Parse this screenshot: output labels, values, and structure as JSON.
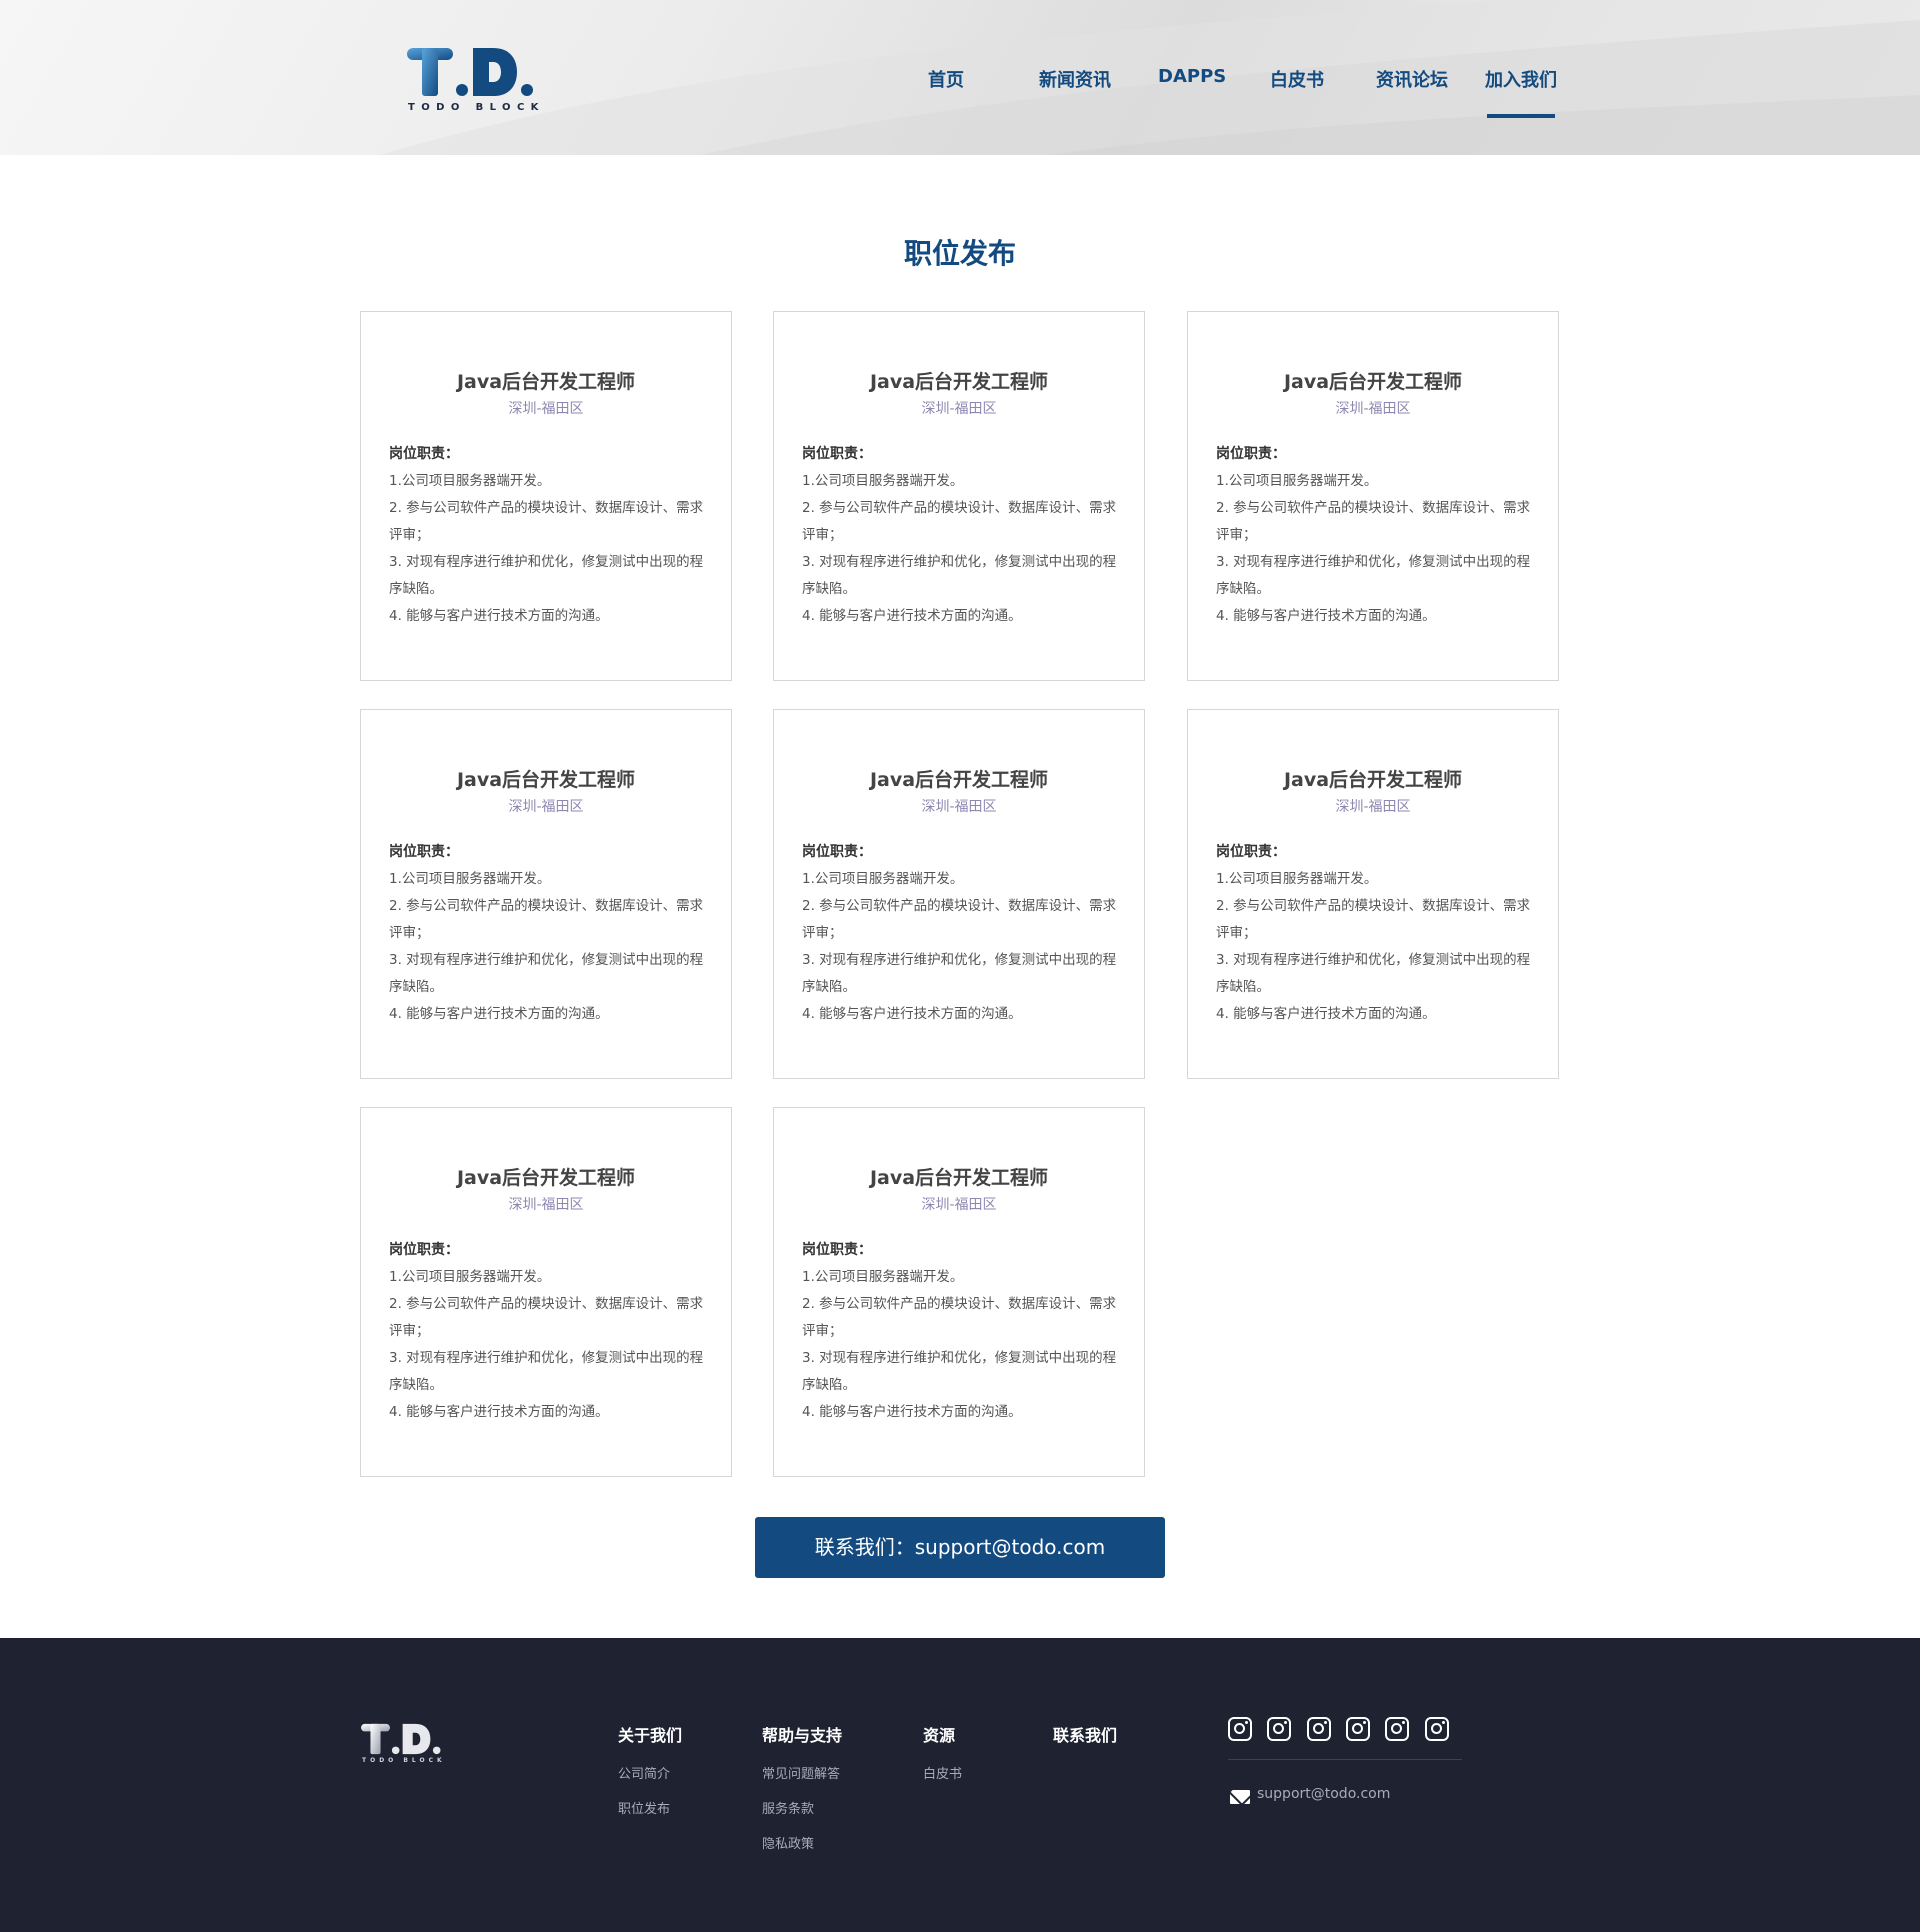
{
  "brand": {
    "logo_text": "T.D.",
    "logo_subtext": "TODO BLOCK"
  },
  "nav": {
    "items": [
      {
        "label": "首页"
      },
      {
        "label": "新闻资讯"
      },
      {
        "label": "DAPPS"
      },
      {
        "label": "白皮书"
      },
      {
        "label": "资讯论坛"
      },
      {
        "label": "加入我们"
      }
    ],
    "active": "加入我们"
  },
  "page_title": "职位发布",
  "jobs": [
    {
      "title": "Java后台开发工程师",
      "location": "深圳-福田区",
      "resp_label": "岗位职责：",
      "duties": [
        "1.公司项目服务器端开发。",
        "2. 参与公司软件产品的模块设计、数据库设计、需求评审；",
        "3. 对现有程序进行维护和优化，修复测试中出现的程序缺陷。",
        "4. 能够与客户进行技术方面的沟通。"
      ]
    },
    {
      "title": "Java后台开发工程师",
      "location": "深圳-福田区",
      "resp_label": "岗位职责：",
      "duties": [
        "1.公司项目服务器端开发。",
        "2. 参与公司软件产品的模块设计、数据库设计、需求评审；",
        "3. 对现有程序进行维护和优化，修复测试中出现的程序缺陷。",
        "4. 能够与客户进行技术方面的沟通。"
      ]
    },
    {
      "title": "Java后台开发工程师",
      "location": "深圳-福田区",
      "resp_label": "岗位职责：",
      "duties": [
        "1.公司项目服务器端开发。",
        "2. 参与公司软件产品的模块设计、数据库设计、需求评审；",
        "3. 对现有程序进行维护和优化，修复测试中出现的程序缺陷。",
        "4. 能够与客户进行技术方面的沟通。"
      ]
    },
    {
      "title": "Java后台开发工程师",
      "location": "深圳-福田区",
      "resp_label": "岗位职责：",
      "duties": [
        "1.公司项目服务器端开发。",
        "2. 参与公司软件产品的模块设计、数据库设计、需求评审；",
        "3. 对现有程序进行维护和优化，修复测试中出现的程序缺陷。",
        "4. 能够与客户进行技术方面的沟通。"
      ]
    },
    {
      "title": "Java后台开发工程师",
      "location": "深圳-福田区",
      "resp_label": "岗位职责：",
      "duties": [
        "1.公司项目服务器端开发。",
        "2. 参与公司软件产品的模块设计、数据库设计、需求评审；",
        "3. 对现有程序进行维护和优化，修复测试中出现的程序缺陷。",
        "4. 能够与客户进行技术方面的沟通。"
      ]
    },
    {
      "title": "Java后台开发工程师",
      "location": "深圳-福田区",
      "resp_label": "岗位职责：",
      "duties": [
        "1.公司项目服务器端开发。",
        "2. 参与公司软件产品的模块设计、数据库设计、需求评审；",
        "3. 对现有程序进行维护和优化，修复测试中出现的程序缺陷。",
        "4. 能够与客户进行技术方面的沟通。"
      ]
    },
    {
      "title": "Java后台开发工程师",
      "location": "深圳-福田区",
      "resp_label": "岗位职责：",
      "duties": [
        "1.公司项目服务器端开发。",
        "2. 参与公司软件产品的模块设计、数据库设计、需求评审；",
        "3. 对现有程序进行维护和优化，修复测试中出现的程序缺陷。",
        "4. 能够与客户进行技术方面的沟通。"
      ]
    },
    {
      "title": "Java后台开发工程师",
      "location": "深圳-福田区",
      "resp_label": "岗位职责：",
      "duties": [
        "1.公司项目服务器端开发。",
        "2. 参与公司软件产品的模块设计、数据库设计、需求评审；",
        "3. 对现有程序进行维护和优化，修复测试中出现的程序缺陷。",
        "4. 能够与客户进行技术方面的沟通。"
      ]
    }
  ],
  "contact_button": "联系我们：support@todo.com",
  "footer": {
    "columns": [
      {
        "heading": "关于我们",
        "links": [
          "公司简介",
          "职位发布"
        ]
      },
      {
        "heading": "帮助与支持",
        "links": [
          "常见问题解答",
          "服务条款",
          "隐私政策"
        ]
      },
      {
        "heading": "资源",
        "links": [
          "白皮书"
        ]
      },
      {
        "heading": "联系我们",
        "links": []
      }
    ],
    "social_icons": [
      "instagram-icon",
      "instagram-icon",
      "instagram-icon",
      "instagram-icon",
      "instagram-icon",
      "instagram-icon"
    ],
    "email": "support@todo.com"
  },
  "colors": {
    "primary": "#134a7f",
    "footer_bg": "#1f2231",
    "location_text": "#8d88b0"
  }
}
